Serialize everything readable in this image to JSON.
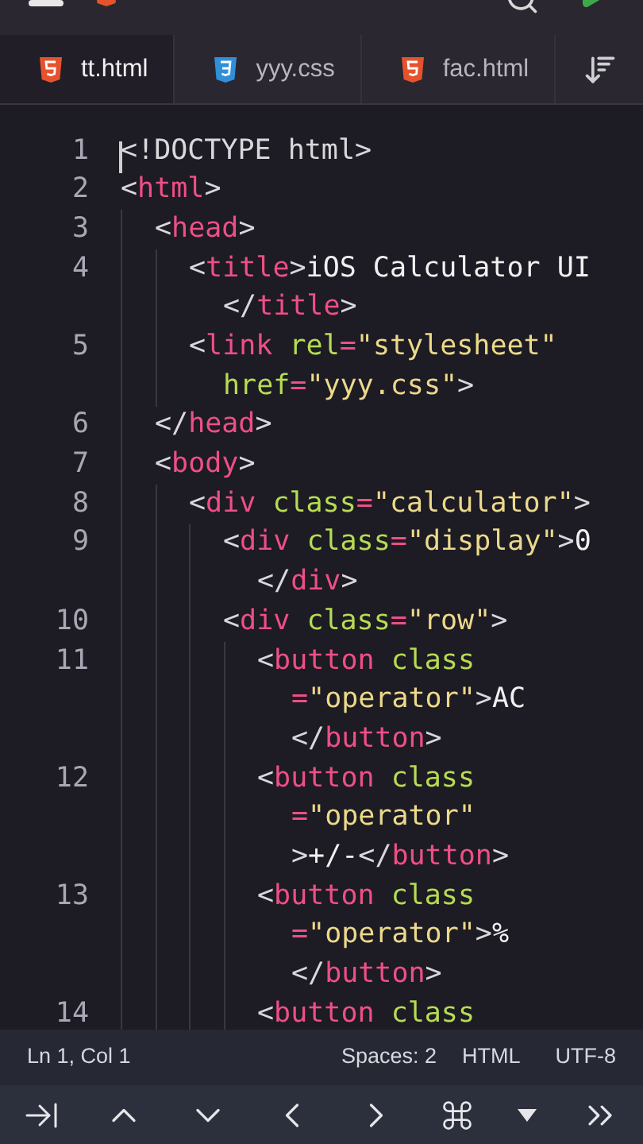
{
  "tabs": [
    {
      "label": "tt.html",
      "kind": "html",
      "selected": true
    },
    {
      "label": "yyy.css",
      "kind": "css",
      "selected": false
    },
    {
      "label": "fac.html",
      "kind": "html",
      "selected": false
    }
  ],
  "code": [
    {
      "number": "1",
      "cursor": true,
      "tokens": [
        {
          "kind": "punct",
          "text": "<!DOCTYPE html>"
        }
      ]
    },
    {
      "number": "2",
      "tokens": [
        {
          "kind": "punct",
          "text": "<"
        },
        {
          "kind": "tag",
          "text": "html"
        },
        {
          "kind": "punct",
          "text": ">"
        }
      ],
      "children": [
        {
          "number": "3",
          "tokens": [
            {
              "kind": "punct",
              "text": "<"
            },
            {
              "kind": "tag",
              "text": "head"
            },
            {
              "kind": "punct",
              "text": ">"
            }
          ],
          "children": [
            {
              "number": "4",
              "tokens": [
                {
                  "kind": "punct",
                  "text": "<"
                },
                {
                  "kind": "tag",
                  "text": "title"
                },
                {
                  "kind": "punct",
                  "text": ">"
                },
                {
                  "kind": "text",
                  "text": "iOS Calculator UI"
                }
              ],
              "wraps": [
                [
                  {
                    "kind": "punct",
                    "text": "</"
                  },
                  {
                    "kind": "tag",
                    "text": "title"
                  },
                  {
                    "kind": "punct",
                    "text": ">"
                  }
                ]
              ]
            },
            {
              "number": "5",
              "tokens": [
                {
                  "kind": "punct",
                  "text": "<"
                },
                {
                  "kind": "tag",
                  "text": "link"
                },
                {
                  "kind": "attr",
                  "space_before": true,
                  "text": "rel"
                },
                {
                  "kind": "equals",
                  "text": "="
                },
                {
                  "kind": "string",
                  "text": "\"stylesheet\""
                }
              ],
              "wraps": [
                [
                  {
                    "kind": "attr",
                    "text": "href"
                  },
                  {
                    "kind": "equals",
                    "text": "="
                  },
                  {
                    "kind": "string",
                    "text": "\"yyy.css\""
                  },
                  {
                    "kind": "punct",
                    "text": ">"
                  }
                ]
              ]
            }
          ]
        },
        {
          "number": "6",
          "tokens": [
            {
              "kind": "punct",
              "text": "</"
            },
            {
              "kind": "tag",
              "text": "head"
            },
            {
              "kind": "punct",
              "text": ">"
            }
          ]
        },
        {
          "number": "7",
          "tokens": [
            {
              "kind": "punct",
              "text": "<"
            },
            {
              "kind": "tag",
              "text": "body"
            },
            {
              "kind": "punct",
              "text": ">"
            }
          ],
          "children": [
            {
              "number": "8",
              "tokens": [
                {
                  "kind": "punct",
                  "text": "<"
                },
                {
                  "kind": "tag",
                  "text": "div"
                },
                {
                  "kind": "attr",
                  "space_before": true,
                  "text": "class"
                },
                {
                  "kind": "equals",
                  "text": "="
                },
                {
                  "kind": "string",
                  "text": "\"calculator\""
                },
                {
                  "kind": "punct",
                  "text": ">"
                }
              ],
              "children": [
                {
                  "number": "9",
                  "tokens": [
                    {
                      "kind": "punct",
                      "text": "<"
                    },
                    {
                      "kind": "tag",
                      "text": "div"
                    },
                    {
                      "kind": "attr",
                      "space_before": true,
                      "text": "class"
                    },
                    {
                      "kind": "equals",
                      "text": "="
                    },
                    {
                      "kind": "string",
                      "text": "\"display\""
                    },
                    {
                      "kind": "punct",
                      "text": ">"
                    },
                    {
                      "kind": "text",
                      "text": "0"
                    }
                  ],
                  "wraps": [
                    [
                      {
                        "kind": "punct",
                        "text": "</"
                      },
                      {
                        "kind": "tag",
                        "text": "div"
                      },
                      {
                        "kind": "punct",
                        "text": ">"
                      }
                    ]
                  ]
                },
                {
                  "number": "10",
                  "tokens": [
                    {
                      "kind": "punct",
                      "text": "<"
                    },
                    {
                      "kind": "tag",
                      "text": "div"
                    },
                    {
                      "kind": "attr",
                      "space_before": true,
                      "text": "class"
                    },
                    {
                      "kind": "equals",
                      "text": "="
                    },
                    {
                      "kind": "string",
                      "text": "\"row\""
                    },
                    {
                      "kind": "punct",
                      "text": ">"
                    }
                  ],
                  "children": [
                    {
                      "number": "11",
                      "tokens": [
                        {
                          "kind": "punct",
                          "text": "<"
                        },
                        {
                          "kind": "tag",
                          "text": "button"
                        },
                        {
                          "kind": "attr",
                          "space_before": true,
                          "text": "class"
                        }
                      ],
                      "wraps": [
                        [
                          {
                            "kind": "equals",
                            "text": "="
                          },
                          {
                            "kind": "string",
                            "text": "\"operator\""
                          },
                          {
                            "kind": "punct",
                            "text": ">"
                          },
                          {
                            "kind": "text",
                            "text": "AC"
                          }
                        ],
                        [
                          {
                            "kind": "punct",
                            "text": "</"
                          },
                          {
                            "kind": "tag",
                            "text": "button"
                          },
                          {
                            "kind": "punct",
                            "text": ">"
                          }
                        ]
                      ]
                    },
                    {
                      "number": "12",
                      "tokens": [
                        {
                          "kind": "punct",
                          "text": "<"
                        },
                        {
                          "kind": "tag",
                          "text": "button"
                        },
                        {
                          "kind": "attr",
                          "space_before": true,
                          "text": "class"
                        }
                      ],
                      "wraps": [
                        [
                          {
                            "kind": "equals",
                            "text": "="
                          },
                          {
                            "kind": "string",
                            "text": "\"operator\""
                          }
                        ],
                        [
                          {
                            "kind": "punct",
                            "text": ">"
                          },
                          {
                            "kind": "text",
                            "text": "+/-"
                          },
                          {
                            "kind": "punct",
                            "text": "</"
                          },
                          {
                            "kind": "tag",
                            "text": "button"
                          },
                          {
                            "kind": "punct",
                            "text": ">"
                          }
                        ]
                      ]
                    },
                    {
                      "number": "13",
                      "tokens": [
                        {
                          "kind": "punct",
                          "text": "<"
                        },
                        {
                          "kind": "tag",
                          "text": "button"
                        },
                        {
                          "kind": "attr",
                          "space_before": true,
                          "text": "class"
                        }
                      ],
                      "wraps": [
                        [
                          {
                            "kind": "equals",
                            "text": "="
                          },
                          {
                            "kind": "string",
                            "text": "\"operator\""
                          },
                          {
                            "kind": "punct",
                            "text": ">"
                          },
                          {
                            "kind": "text",
                            "text": "%"
                          }
                        ],
                        [
                          {
                            "kind": "punct",
                            "text": "</"
                          },
                          {
                            "kind": "tag",
                            "text": "button"
                          },
                          {
                            "kind": "punct",
                            "text": ">"
                          }
                        ]
                      ]
                    },
                    {
                      "number": "14",
                      "tokens": [
                        {
                          "kind": "punct",
                          "text": "<"
                        },
                        {
                          "kind": "tag",
                          "text": "button"
                        },
                        {
                          "kind": "attr",
                          "space_before": true,
                          "text": "class"
                        }
                      ]
                    }
                  ]
                }
              ]
            }
          ]
        }
      ]
    }
  ],
  "status_bar": {
    "position": "Ln 1, Col 1",
    "indent": "Spaces: 2",
    "language": "HTML",
    "encoding": "UTF-8"
  }
}
